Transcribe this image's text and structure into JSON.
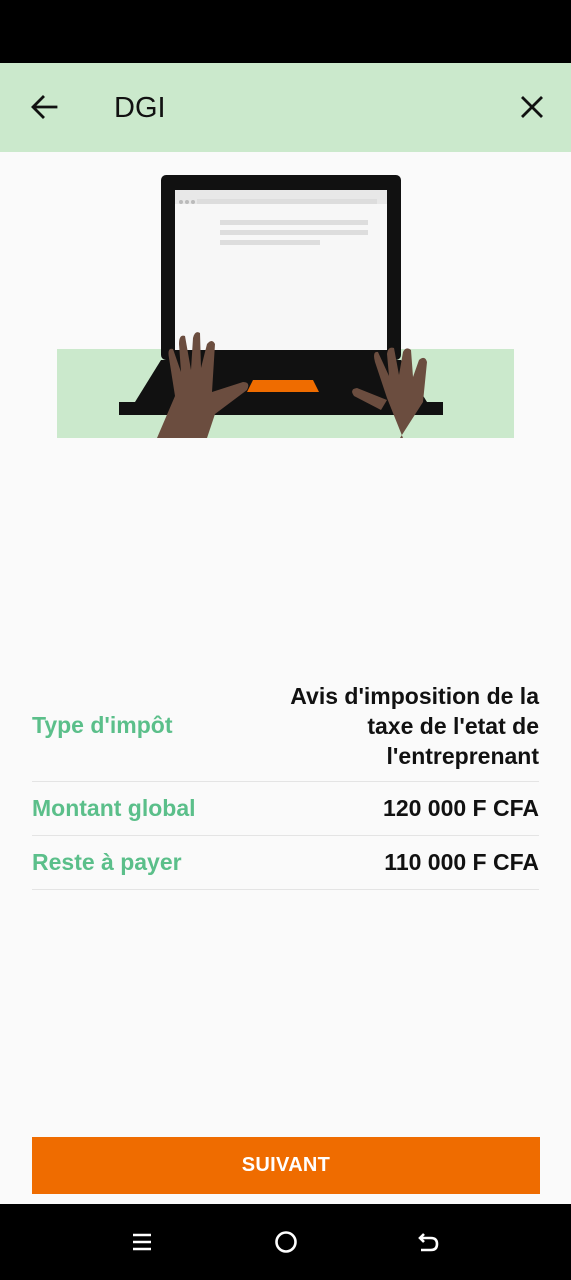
{
  "header": {
    "title": "DGI",
    "back_icon": "arrow-left-icon",
    "close_icon": "close-icon",
    "background": "#cbe9cc"
  },
  "details": [
    {
      "label": "Type d'impôt",
      "value": "Avis d'imposition de la taxe de l'etat de l'entreprenant"
    },
    {
      "label": "Montant global",
      "value": "120 000 F CFA"
    },
    {
      "label": "Reste à payer",
      "value": "110 000 F CFA"
    }
  ],
  "next_button": {
    "label": "SUIVANT"
  },
  "colors": {
    "accent": "#ef6c00",
    "label_green": "#5bbf8a"
  },
  "nav": {
    "menu_icon": "menu-icon",
    "home_icon": "home-circle-icon",
    "back_icon": "back-icon"
  }
}
